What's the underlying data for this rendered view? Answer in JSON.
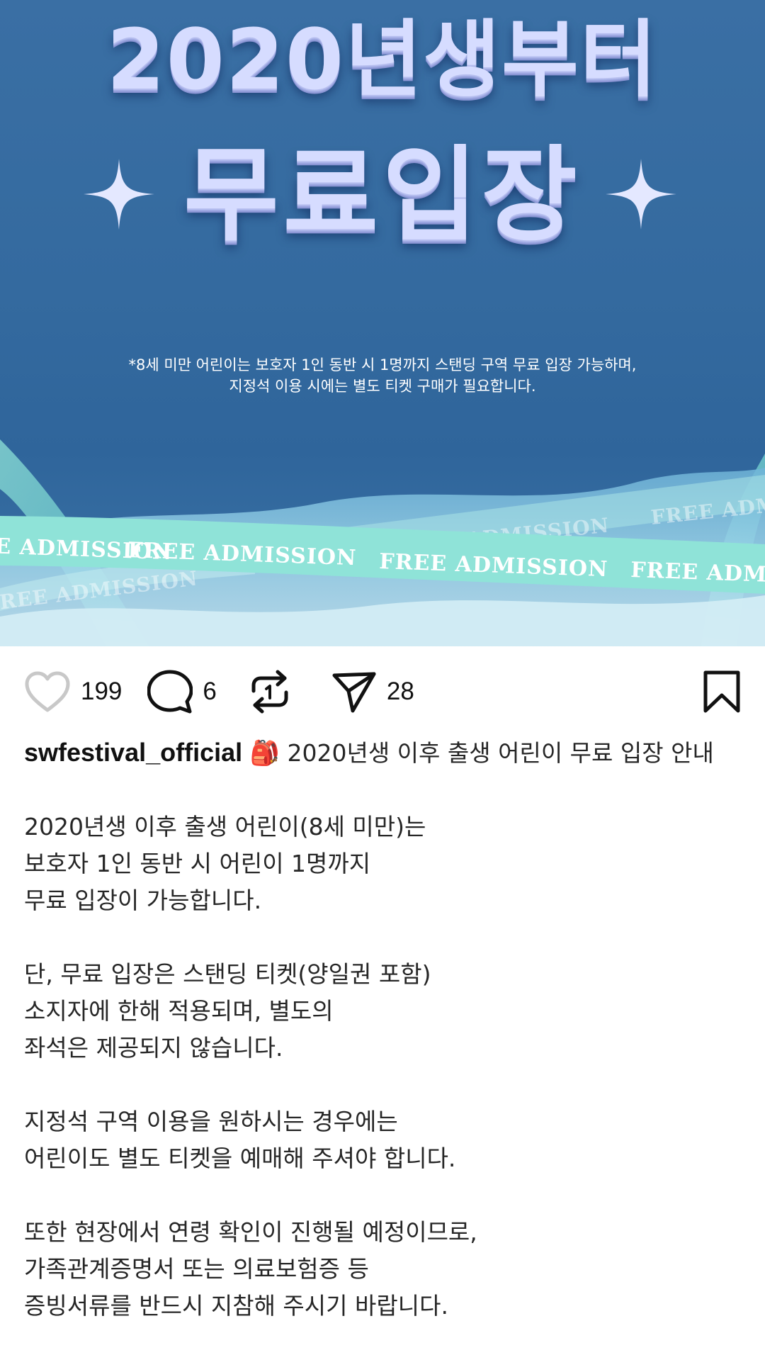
{
  "post": {
    "image": {
      "headline_line1": "2020년생부터",
      "headline_line2": "무료입장",
      "notice_line1": "*8세 미만 어린이는 보호자 1인 동반 시 1명까지 스탠딩 구역 무료 입장 가능하며,",
      "notice_line2": "지정석 이용 시에는 별도 티켓 구매가 필요합니다.",
      "ribbon_text": "FREE ADMISSION",
      "colors": {
        "background": "#346a9f",
        "headline": "#d6dcff",
        "ribbon": "#8fe3d8"
      }
    },
    "actions": {
      "like_icon": "heart-icon",
      "like_count": "199",
      "comment_icon": "comment-icon",
      "comment_count": "6",
      "repost_icon": "repost-icon",
      "share_icon": "send-icon",
      "share_count": "28",
      "save_icon": "bookmark-icon"
    },
    "caption": {
      "username": "swfestival_official",
      "emoji": "🎒",
      "title": "2020년생 이후 출생 어린이 무료 입장 안내",
      "paragraphs": [
        "2020년생 이후 출생 어린이(8세 미만)는\n보호자 1인 동반 시 어린이 1명까지\n무료 입장이 가능합니다.",
        "단, 무료 입장은 스탠딩 티켓(양일권 포함)\n소지자에 한해 적용되며, 별도의\n좌석은 제공되지 않습니다.",
        "지정석 구역 이용을 원하시는 경우에는\n어린이도 별도 티켓을 예매해 주셔야 합니다.",
        "또한 현장에서 연령 확인이 진행될 예정이므로,\n가족관계증명서 또는 의료보험증 등\n증빙서류를 반드시 지참해 주시기 바랍니다."
      ]
    }
  }
}
